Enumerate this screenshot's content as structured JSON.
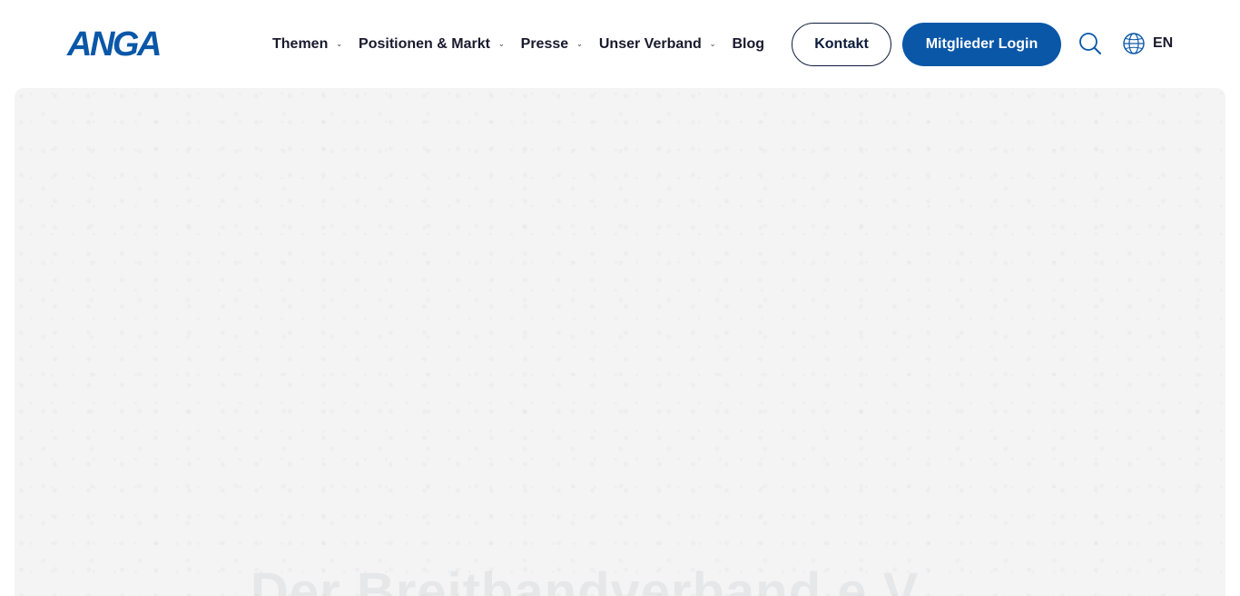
{
  "header": {
    "logo_text": "ANGA",
    "nav": [
      {
        "label": "Themen",
        "has_dropdown": true
      },
      {
        "label": "Positionen & Markt",
        "has_dropdown": true
      },
      {
        "label": "Presse",
        "has_dropdown": true
      },
      {
        "label": "Unser Verband",
        "has_dropdown": true
      },
      {
        "label": "Blog",
        "has_dropdown": false
      }
    ],
    "contact_label": "Kontakt",
    "login_label": "Mitglieder Login",
    "language_label": "EN",
    "search_icon": "search-icon",
    "language_icon": "globe-icon"
  },
  "hero": {
    "title": "Der Breitbandverband e.V."
  },
  "colors": {
    "brand_blue": "#0a57a8",
    "dark_navy": "#0c1b3a",
    "hero_background": "#f4f4f5"
  }
}
